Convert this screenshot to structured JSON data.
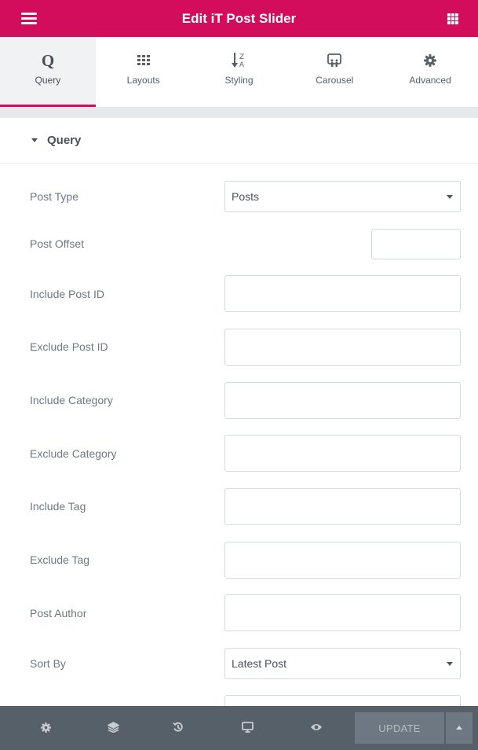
{
  "header": {
    "title": "Edit iT Post Slider"
  },
  "tabs": [
    {
      "label": "Query",
      "icon": "search-q-icon",
      "active": true
    },
    {
      "label": "Layouts",
      "icon": "grid-icon",
      "active": false
    },
    {
      "label": "Styling",
      "icon": "sort-az-icon",
      "active": false
    },
    {
      "label": "Carousel",
      "icon": "carousel-icon",
      "active": false
    },
    {
      "label": "Advanced",
      "icon": "gear-icon",
      "active": false
    }
  ],
  "section": {
    "title": "Query"
  },
  "fields": {
    "post_type": {
      "label": "Post Type",
      "value": "Posts"
    },
    "post_offset": {
      "label": "Post Offset",
      "value": ""
    },
    "include_post_id": {
      "label": "Include Post ID",
      "value": ""
    },
    "exclude_post_id": {
      "label": "Exclude Post ID",
      "value": ""
    },
    "include_category": {
      "label": "Include Category",
      "value": ""
    },
    "exclude_category": {
      "label": "Exclude Category",
      "value": ""
    },
    "include_tag": {
      "label": "Include Tag",
      "value": ""
    },
    "exclude_tag": {
      "label": "Exclude Tag",
      "value": ""
    },
    "post_author": {
      "label": "Post Author",
      "value": ""
    },
    "sort_by": {
      "label": "Sort By",
      "value": "Latest Post"
    }
  },
  "footer": {
    "update_label": "UPDATE"
  },
  "colors": {
    "accent": "#d30c5c",
    "footer_bg": "#556068",
    "text": "#6d7882"
  }
}
